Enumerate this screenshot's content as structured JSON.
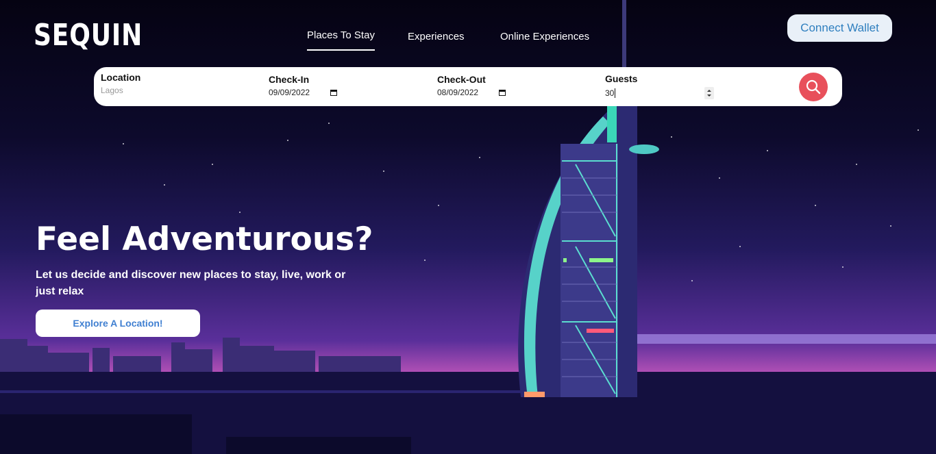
{
  "brand": {
    "logo": "SEQUIN"
  },
  "nav": {
    "items": [
      {
        "label": "Places To Stay",
        "active": true
      },
      {
        "label": "Experiences",
        "active": false
      },
      {
        "label": "Online Experiences",
        "active": false
      }
    ]
  },
  "header": {
    "wallet_label": "Connect Wallet"
  },
  "search": {
    "location": {
      "label": "Location",
      "placeholder": "Lagos"
    },
    "checkin": {
      "label": "Check-In",
      "value": "09/09/2022",
      "icon": "calendar-icon"
    },
    "checkout": {
      "label": "Check-Out",
      "value": "08/09/2022",
      "icon": "calendar-icon"
    },
    "guests": {
      "label": "Guests",
      "value": "30"
    },
    "button_icon": "search-icon"
  },
  "hero": {
    "title": "Feel Adventurous?",
    "subtitle": "Let us decide and discover new places to stay, live, work or just relax",
    "cta_label": "Explore A Location!"
  },
  "colors": {
    "accent": "#e8505b",
    "wallet_text": "#2f7fbf",
    "cta_text": "#3f7fd1",
    "sky_dark": "#050312",
    "horizon": "#b04fb5"
  }
}
